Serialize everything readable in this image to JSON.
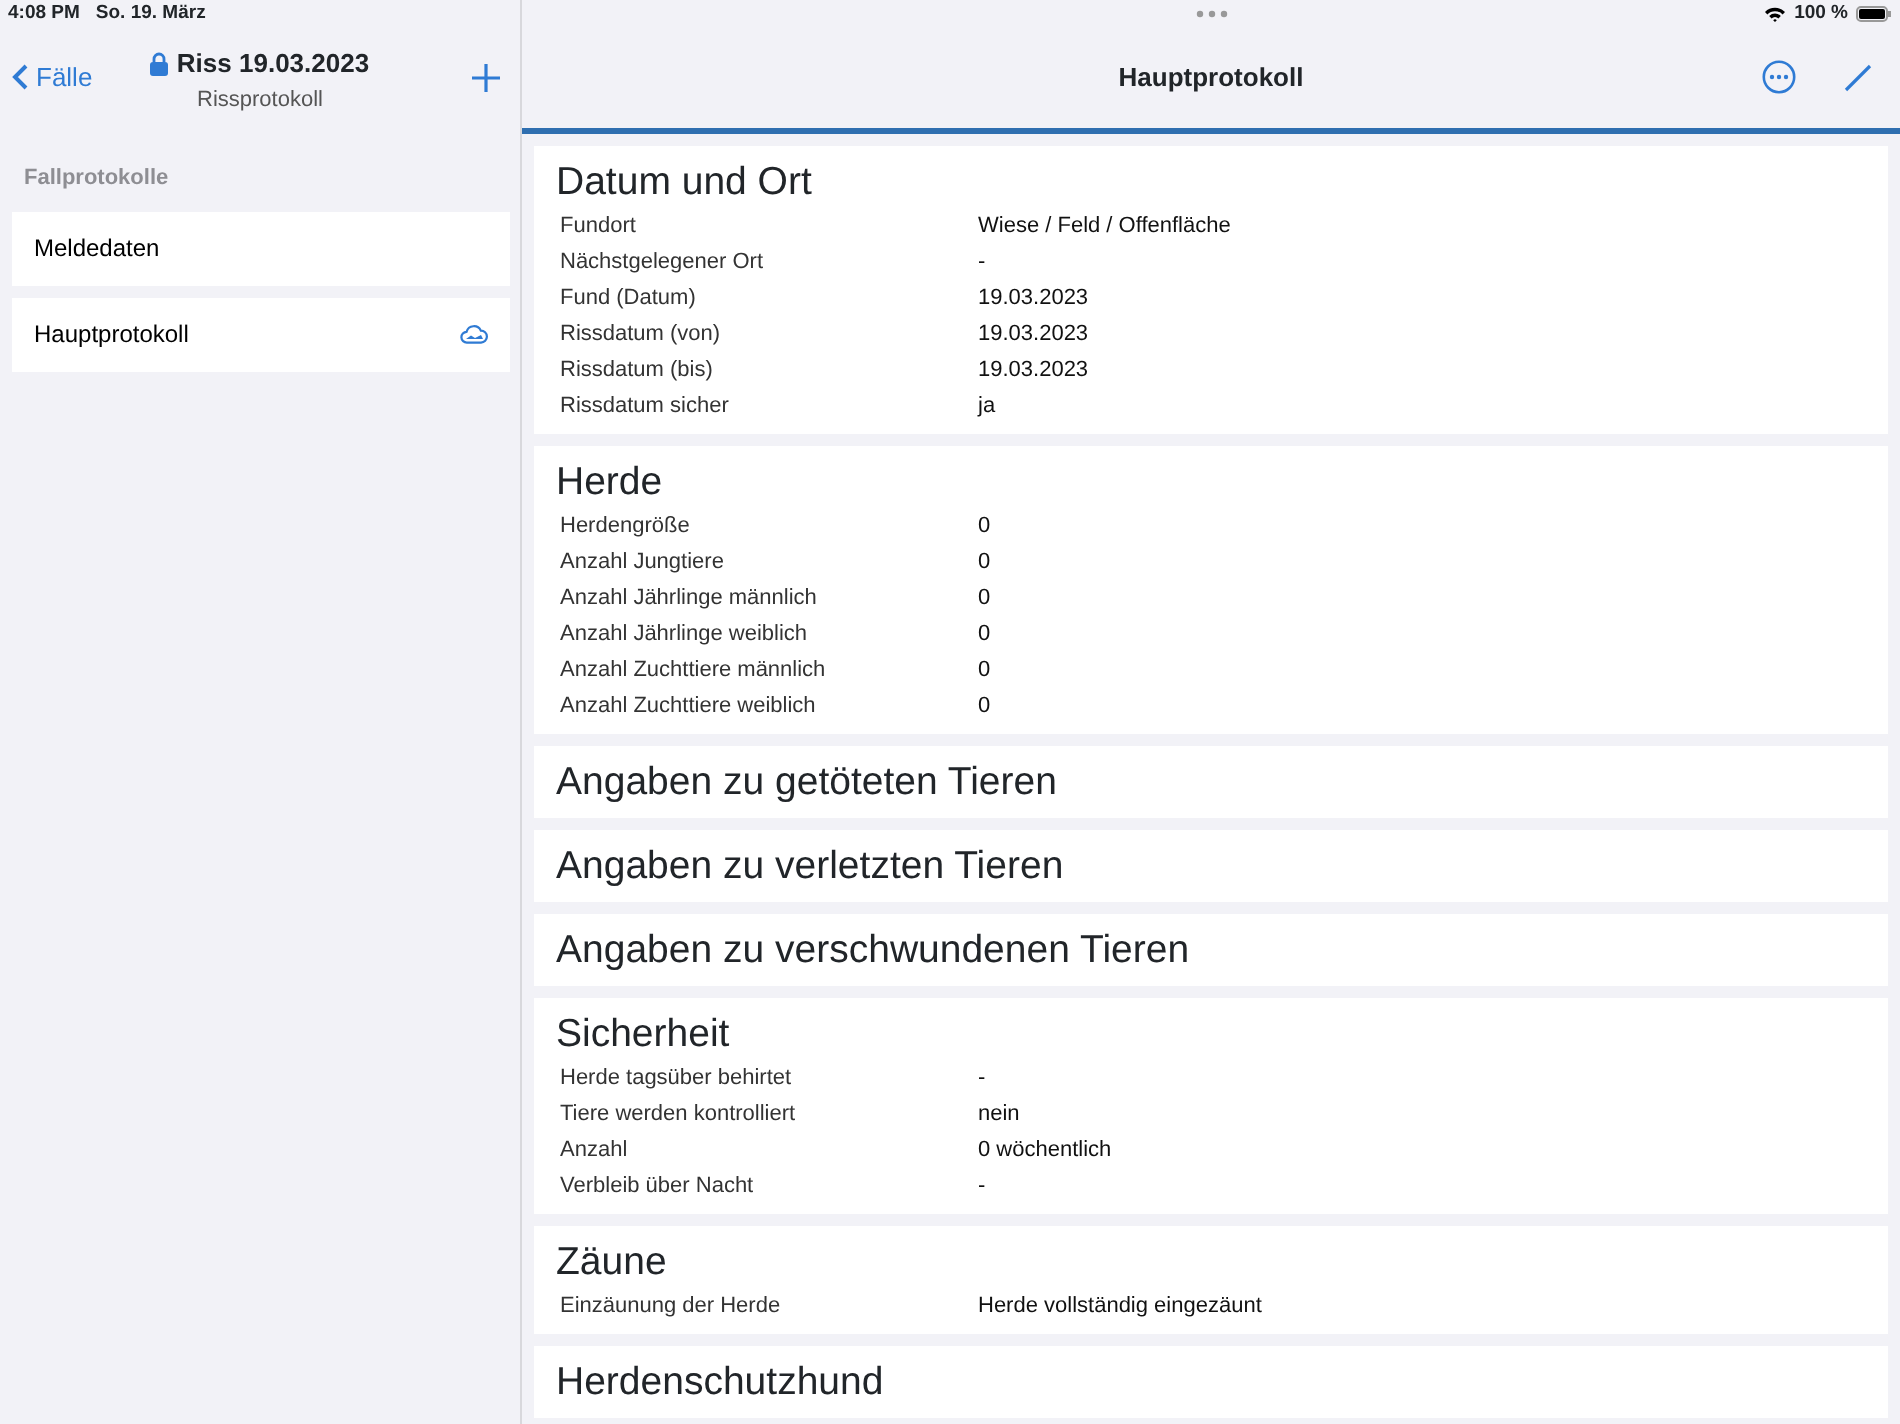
{
  "status_bar": {
    "time": "4:08 PM",
    "date": "So. 19. März",
    "battery": "100 %"
  },
  "sidebar": {
    "back": "Fälle",
    "title": "Riss 19.03.2023",
    "subtitle": "Rissprotokoll",
    "locked": true,
    "section": "Fallprotokolle",
    "items": [
      {
        "label": "Meldedaten",
        "cloud": false
      },
      {
        "label": "Hauptprotokoll",
        "cloud": true
      }
    ]
  },
  "detail": {
    "title": "Hauptprotokoll",
    "sections": [
      {
        "title": "Datum und Ort",
        "rows": [
          {
            "label": "Fundort",
            "value": "Wiese / Feld / Offenfläche"
          },
          {
            "label": "Nächstgelegener Ort",
            "value": "-"
          },
          {
            "label": "Fund (Datum)",
            "value": "19.03.2023"
          },
          {
            "label": "Rissdatum (von)",
            "value": "19.03.2023"
          },
          {
            "label": "Rissdatum (bis)",
            "value": "19.03.2023"
          },
          {
            "label": "Rissdatum sicher",
            "value": "ja"
          }
        ]
      },
      {
        "title": "Herde",
        "rows": [
          {
            "label": "Herdengröße",
            "value": "0"
          },
          {
            "label": "Anzahl Jungtiere",
            "value": "0"
          },
          {
            "label": "Anzahl Jährlinge männlich",
            "value": "0"
          },
          {
            "label": "Anzahl Jährlinge weiblich",
            "value": "0"
          },
          {
            "label": "Anzahl Zuchttiere männlich",
            "value": "0"
          },
          {
            "label": "Anzahl Zuchttiere weiblich",
            "value": "0"
          }
        ]
      },
      {
        "title": "Angaben zu getöteten Tieren"
      },
      {
        "title": "Angaben zu verletzten Tieren"
      },
      {
        "title": "Angaben zu verschwundenen Tieren"
      },
      {
        "title": "Sicherheit",
        "rows": [
          {
            "label": "Herde tagsüber behirtet",
            "value": "-"
          },
          {
            "label": "Tiere werden kontrolliert",
            "value": "nein"
          },
          {
            "label": "Anzahl",
            "value": "0 wöchentlich"
          },
          {
            "label": "Verbleib über Nacht",
            "value": "-"
          }
        ]
      },
      {
        "title": "Zäune",
        "rows": [
          {
            "label": "Einzäunung der Herde",
            "value": "Herde vollständig eingezäunt"
          }
        ]
      },
      {
        "title": "Herdenschutzhund"
      }
    ]
  }
}
